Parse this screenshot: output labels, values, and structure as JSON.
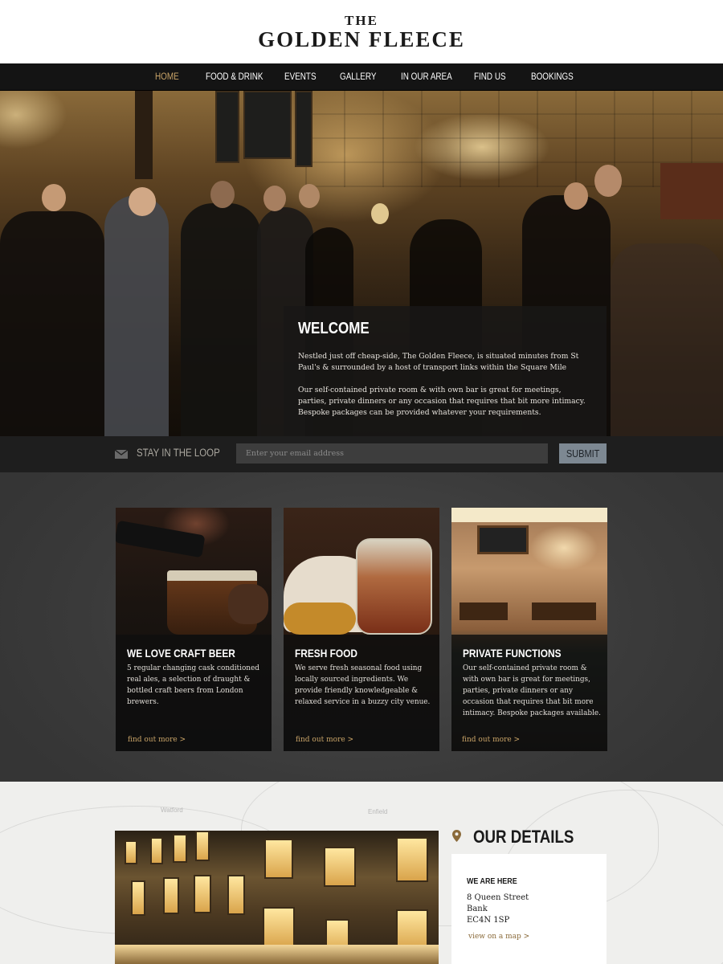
{
  "header": {
    "logo_top": "THE",
    "logo_main": "GOLDEN FLEECE"
  },
  "nav": {
    "items": [
      {
        "label": "HOME",
        "active": true
      },
      {
        "label": "FOOD & DRINK",
        "active": false
      },
      {
        "label": "EVENTS",
        "active": false
      },
      {
        "label": "GALLERY",
        "active": false
      },
      {
        "label": "IN OUR AREA",
        "active": false
      },
      {
        "label": "FIND US",
        "active": false
      },
      {
        "label": "BOOKINGS",
        "active": false
      }
    ]
  },
  "welcome": {
    "title": "WELCOME",
    "paragraph_1": "Nestled just off cheap-side, The Golden Fleece, is situated minutes from St Paul's & surrounded by a host of transport links within the Square Mile",
    "paragraph_2": "Our self-contained private room & with own bar is great for meetings, parties, private dinners or any occasion that requires that bit more intimacy. Bespoke packages can be provided whatever your requirements."
  },
  "newsletter": {
    "icon": "envelope-icon",
    "label": "STAY IN THE LOOP",
    "placeholder": "Enter your email address",
    "button_label": "SUBMIT"
  },
  "features": [
    {
      "title": "WE LOVE CRAFT BEER",
      "text": "5 regular changing cask conditioned real ales, a selection of draught & bottled craft beers from London brewers.",
      "link": "find out more >"
    },
    {
      "title": "FRESH FOOD",
      "text": "We serve fresh seasonal food using locally sourced ingredients. We provide friendly knowledgeable & relaxed service in a buzzy city venue.",
      "link": "find out more >"
    },
    {
      "title": "PRIVATE FUNCTIONS",
      "text": "Our self-contained private room & with own bar is great for meetings, parties, private dinners or any occasion that requires that bit more intimacy. Bespoke packages available.",
      "link": "find out more >"
    }
  ],
  "details": {
    "title": "OUR DETAILS",
    "icon": "map-pin-icon",
    "map_labels": [
      "Watford",
      "Enfield"
    ],
    "here_title": "WE ARE HERE",
    "address": [
      "8 Queen Street",
      "Bank",
      "EC4N 1SP"
    ],
    "map_link": "view on a map >"
  },
  "colors": {
    "accent_gold": "#c9a468",
    "nav_bg": "#141414",
    "submit_bg": "#7d8892"
  }
}
